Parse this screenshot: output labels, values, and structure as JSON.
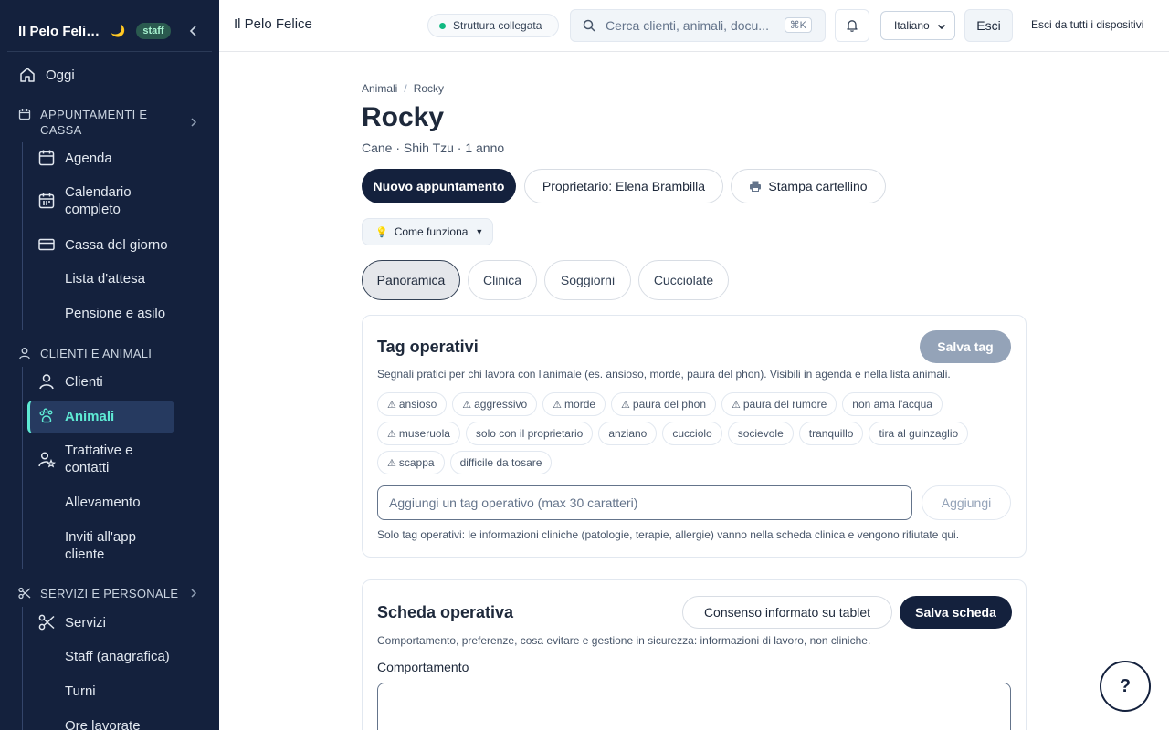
{
  "sidebar": {
    "brand": "Il Pelo Feli…",
    "moon": "🌙",
    "badge": "staff",
    "today": "Oggi",
    "sections": [
      {
        "title": "APPUNTAMENTI E CASSA",
        "items": [
          "Agenda",
          "Calendario completo",
          "Cassa del giorno",
          "Lista d'attesa",
          "Pensione e asilo"
        ]
      },
      {
        "title": "CLIENTI E ANIMALI",
        "items": [
          "Clienti",
          "Animali",
          "Trattative e contatti",
          "Allevamento",
          "Inviti all'app cliente"
        ]
      },
      {
        "title": "SERVIZI E PERSONALE",
        "items": [
          "Servizi",
          "Staff (anagrafica)",
          "Turni",
          "Ore lavorate"
        ]
      }
    ],
    "active_item": "Animali",
    "colors": {
      "background": "#14213d",
      "accent": "#5eead4"
    }
  },
  "topbar": {
    "title": "Il Pelo Felice",
    "connection": "Struttura collegata",
    "search_placeholder": "Cerca clienti, animali, docu...",
    "search_shortcut": "⌘K",
    "language": "Italiano",
    "exit": "Esci",
    "exit_all": "Esci da tutti i dispositivi"
  },
  "page": {
    "breadcrumb": [
      "Animali",
      "Rocky"
    ],
    "title": "Rocky",
    "subtitle": "Cane · Shih Tzu · 1 anno",
    "actions": {
      "new_appointment": "Nuovo appuntamento",
      "owner": "Proprietario: Elena Brambilla",
      "print": "Stampa cartellino"
    },
    "how_it_works": "Come funziona",
    "tabs": [
      "Panoramica",
      "Clinica",
      "Soggiorni",
      "Cucciolate"
    ],
    "active_tab": "Panoramica"
  },
  "tags_card": {
    "title": "Tag operativi",
    "save": "Salva tag",
    "description": "Segnali pratici per chi lavora con l'animale (es. ansioso, morde, paura del phon). Visibili in agenda e nella lista animali.",
    "tags": [
      {
        "label": "ansioso",
        "warn": true
      },
      {
        "label": "aggressivo",
        "warn": true
      },
      {
        "label": "morde",
        "warn": true
      },
      {
        "label": "paura del phon",
        "warn": true
      },
      {
        "label": "paura del rumore",
        "warn": true
      },
      {
        "label": "non ama l'acqua",
        "warn": false
      },
      {
        "label": "museruola",
        "warn": true
      },
      {
        "label": "solo con il proprietario",
        "warn": false
      },
      {
        "label": "anziano",
        "warn": false
      },
      {
        "label": "cucciolo",
        "warn": false
      },
      {
        "label": "socievole",
        "warn": false
      },
      {
        "label": "tranquillo",
        "warn": false
      },
      {
        "label": "tira al guinzaglio",
        "warn": false
      },
      {
        "label": "scappa",
        "warn": true
      },
      {
        "label": "difficile da tosare",
        "warn": false
      }
    ],
    "input_placeholder": "Aggiungi un tag operativo (max 30 caratteri)",
    "add": "Aggiungi",
    "note": "Solo tag operativi: le informazioni cliniche (patologie, terapie, allergie) vanno nella scheda clinica e vengono rifiutate qui."
  },
  "sheet_card": {
    "title": "Scheda operativa",
    "consent": "Consenso informato su tablet",
    "save": "Salva scheda",
    "description": "Comportamento, preferenze, cosa evitare e gestione in sicurezza: informazioni di lavoro, non cliniche.",
    "field_label": "Comportamento"
  },
  "help": "?"
}
